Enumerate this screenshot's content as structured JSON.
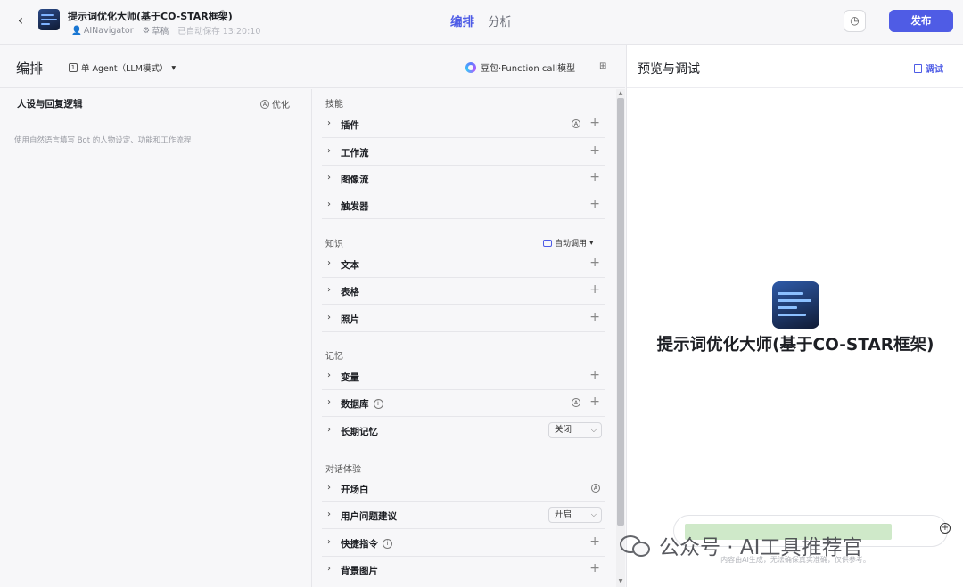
{
  "header": {
    "bot_name": "提示词优化大师(基于CO-STAR框架)",
    "author": "AINavigator",
    "status": "草稿",
    "autosave": "已自动保存 13:20:10",
    "tabs": [
      "编排",
      "分析"
    ],
    "publish_label": "发布"
  },
  "edit": {
    "title": "编排",
    "mode": "单 Agent（LLM模式）",
    "model": "豆包·Function call模型"
  },
  "persona": {
    "title": "人设与回复逻辑",
    "optimize_label": "优化",
    "placeholder": "使用自然语言填写 Bot 的人物设定、功能和工作流程"
  },
  "skills": {
    "sections": {
      "skill": "技能",
      "knowledge": "知识",
      "memory": "记忆",
      "dialog": "对话体验"
    },
    "auto_call": "自动调用",
    "rows": {
      "plugin": "插件",
      "workflow": "工作流",
      "imageflow": "图像流",
      "trigger": "触发器",
      "text": "文本",
      "table": "表格",
      "photo": "照片",
      "variable": "变量",
      "database": "数据库",
      "longmem": "长期记忆",
      "opening": "开场白",
      "suggest": "用户问题建议",
      "shortcut": "快捷指令",
      "bgimage": "背景图片"
    },
    "longmem_value": "关闭",
    "suggest_value": "开启"
  },
  "preview": {
    "title": "预览与调试",
    "debug_label": "调试",
    "bot_name": "提示词优化大师(基于CO-STAR框架)",
    "disclaimer": "内容由AI生成，无法确保真实准确，仅供参考。"
  },
  "watermark": "公众号 · AI工具推荐官",
  "icons": {
    "back": "chevron-left-icon",
    "edit": "pencil-icon",
    "history": "history-icon",
    "plus": "plus-icon",
    "send": "send-icon"
  },
  "colors": {
    "accent": "#4f5ce5",
    "dot": "#7e5be6"
  }
}
